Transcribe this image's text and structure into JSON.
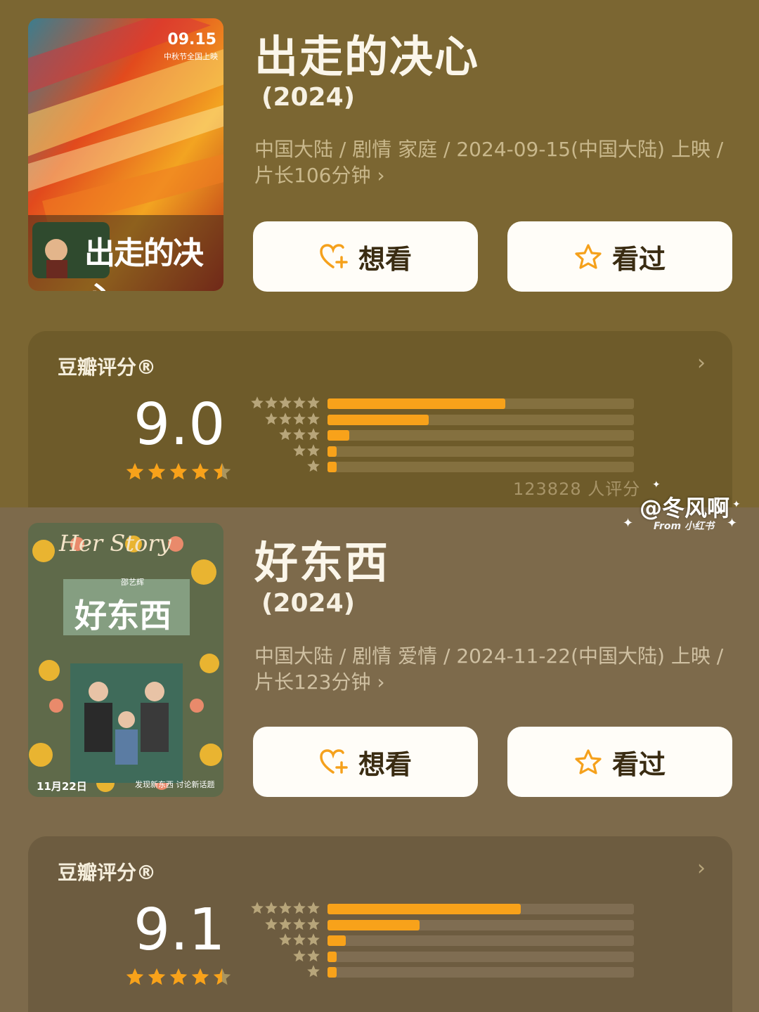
{
  "colors": {
    "accent": "#f8a21a",
    "star": "#f8a21a",
    "button_bg": "#fffdf8"
  },
  "movies": [
    {
      "title": "出走的决心",
      "year": "(2024)",
      "meta": "中国大陆 / 剧情 家庭 / 2024-09-15(中国大陆) 上映 / 片长106分钟 ›",
      "poster": {
        "date": "09.15",
        "subtitle": "中秋节全国上映",
        "calligraphy": "出走的决心"
      },
      "want_label": "想看",
      "seen_label": "看过",
      "rating": {
        "label": "豆瓣评分®",
        "score": "9.0",
        "stars": 4.5,
        "distribution": [
          0.58,
          0.33,
          0.07,
          0.03,
          0.03
        ],
        "count": "123828 人评分"
      }
    },
    {
      "title": "好东西",
      "year": "(2024)",
      "meta": "中国大陆 / 剧情 爱情 / 2024-11-22(中国大陆) 上映 / 片长123分钟 ›",
      "poster": {
        "header": "Her Story",
        "calligraphy": "好东西",
        "director": "邵艺辉",
        "date": "11月22日",
        "tagline": "发现新东西 讨论新话题"
      },
      "want_label": "想看",
      "seen_label": "看过",
      "rating": {
        "label": "豆瓣评分®",
        "score": "9.1",
        "stars": 4.5,
        "distribution": [
          0.63,
          0.3,
          0.06,
          0.03,
          0.03
        ]
      }
    }
  ],
  "watermark": {
    "name": "@冬风啊",
    "from": "From 小红书"
  },
  "icons": {
    "want": "heart-plus-icon",
    "seen": "star-outline-icon",
    "arrow": "chevron-right-icon"
  }
}
